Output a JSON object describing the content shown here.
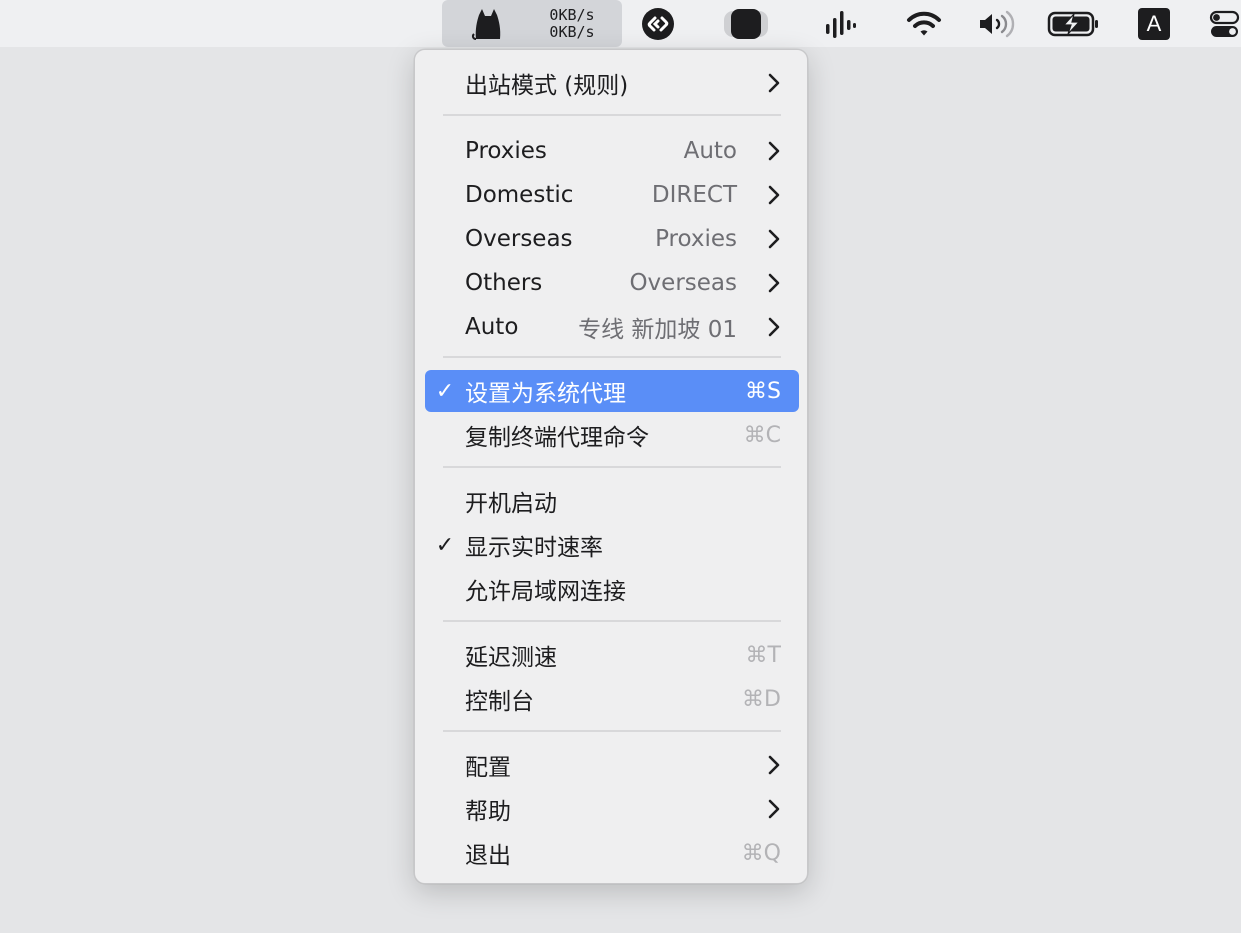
{
  "menubar": {
    "upload_speed": "0KB/s",
    "download_speed": "0KB/s",
    "input_source": "A",
    "icons": [
      "clash-cat-icon",
      "shazam-icon",
      "screen-mirror-icon",
      "audio-waves-icon",
      "wifi-icon",
      "volume-icon",
      "battery-charging-icon",
      "control-center-icon"
    ]
  },
  "menu": {
    "mode": {
      "label": "出站模式 (规则)"
    },
    "groups": [
      {
        "name": "Proxies",
        "value": "Auto"
      },
      {
        "name": "Domestic",
        "value": "DIRECT"
      },
      {
        "name": "Overseas",
        "value": "Proxies"
      },
      {
        "name": "Others",
        "value": "Overseas"
      },
      {
        "name": "Auto",
        "value": "专线 新加坡 01"
      }
    ],
    "set_system_proxy": {
      "label": "设置为系统代理",
      "shortcut": "⌘S",
      "checked": true
    },
    "copy_terminal_cmd": {
      "label": "复制终端代理命令",
      "shortcut": "⌘C"
    },
    "launch_at_login": {
      "label": "开机启动"
    },
    "show_speed": {
      "label": "显示实时速率",
      "checked": true
    },
    "allow_lan": {
      "label": "允许局域网连接"
    },
    "benchmark": {
      "label": "延迟测速",
      "shortcut": "⌘T"
    },
    "dashboard": {
      "label": "控制台",
      "shortcut": "⌘D"
    },
    "config": {
      "label": "配置"
    },
    "help": {
      "label": "帮助"
    },
    "quit": {
      "label": "退出",
      "shortcut": "⌘Q"
    },
    "check_mark": "✓"
  },
  "colors": {
    "highlight": "#5a8ef7",
    "background": "#e4e5e7",
    "menu_bg": "#efeff0"
  }
}
